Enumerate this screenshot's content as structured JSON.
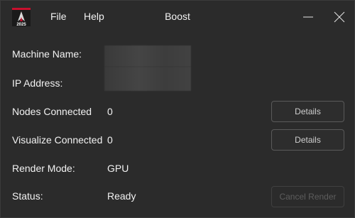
{
  "menu": {
    "file": "File",
    "help": "Help"
  },
  "window": {
    "title": "Boost",
    "app_icon_text": "2025"
  },
  "fields": {
    "machine_name": {
      "label": "Machine Name:",
      "value": ""
    },
    "ip_address": {
      "label": "IP Address:",
      "value": ""
    },
    "nodes_connected": {
      "label": "Nodes Connected",
      "value": "0"
    },
    "visualize_connected": {
      "label": "Visualize Connected",
      "value": "0"
    },
    "render_mode": {
      "label": "Render Mode:",
      "value": "GPU"
    },
    "status": {
      "label": "Status:",
      "value": "Ready"
    }
  },
  "buttons": {
    "nodes_details": "Details",
    "visualize_details": "Details",
    "cancel_render": "Cancel Render"
  },
  "colors": {
    "background": "#2b2b2b",
    "text": "#f2f2f2",
    "icon_red": "#c8102e"
  }
}
